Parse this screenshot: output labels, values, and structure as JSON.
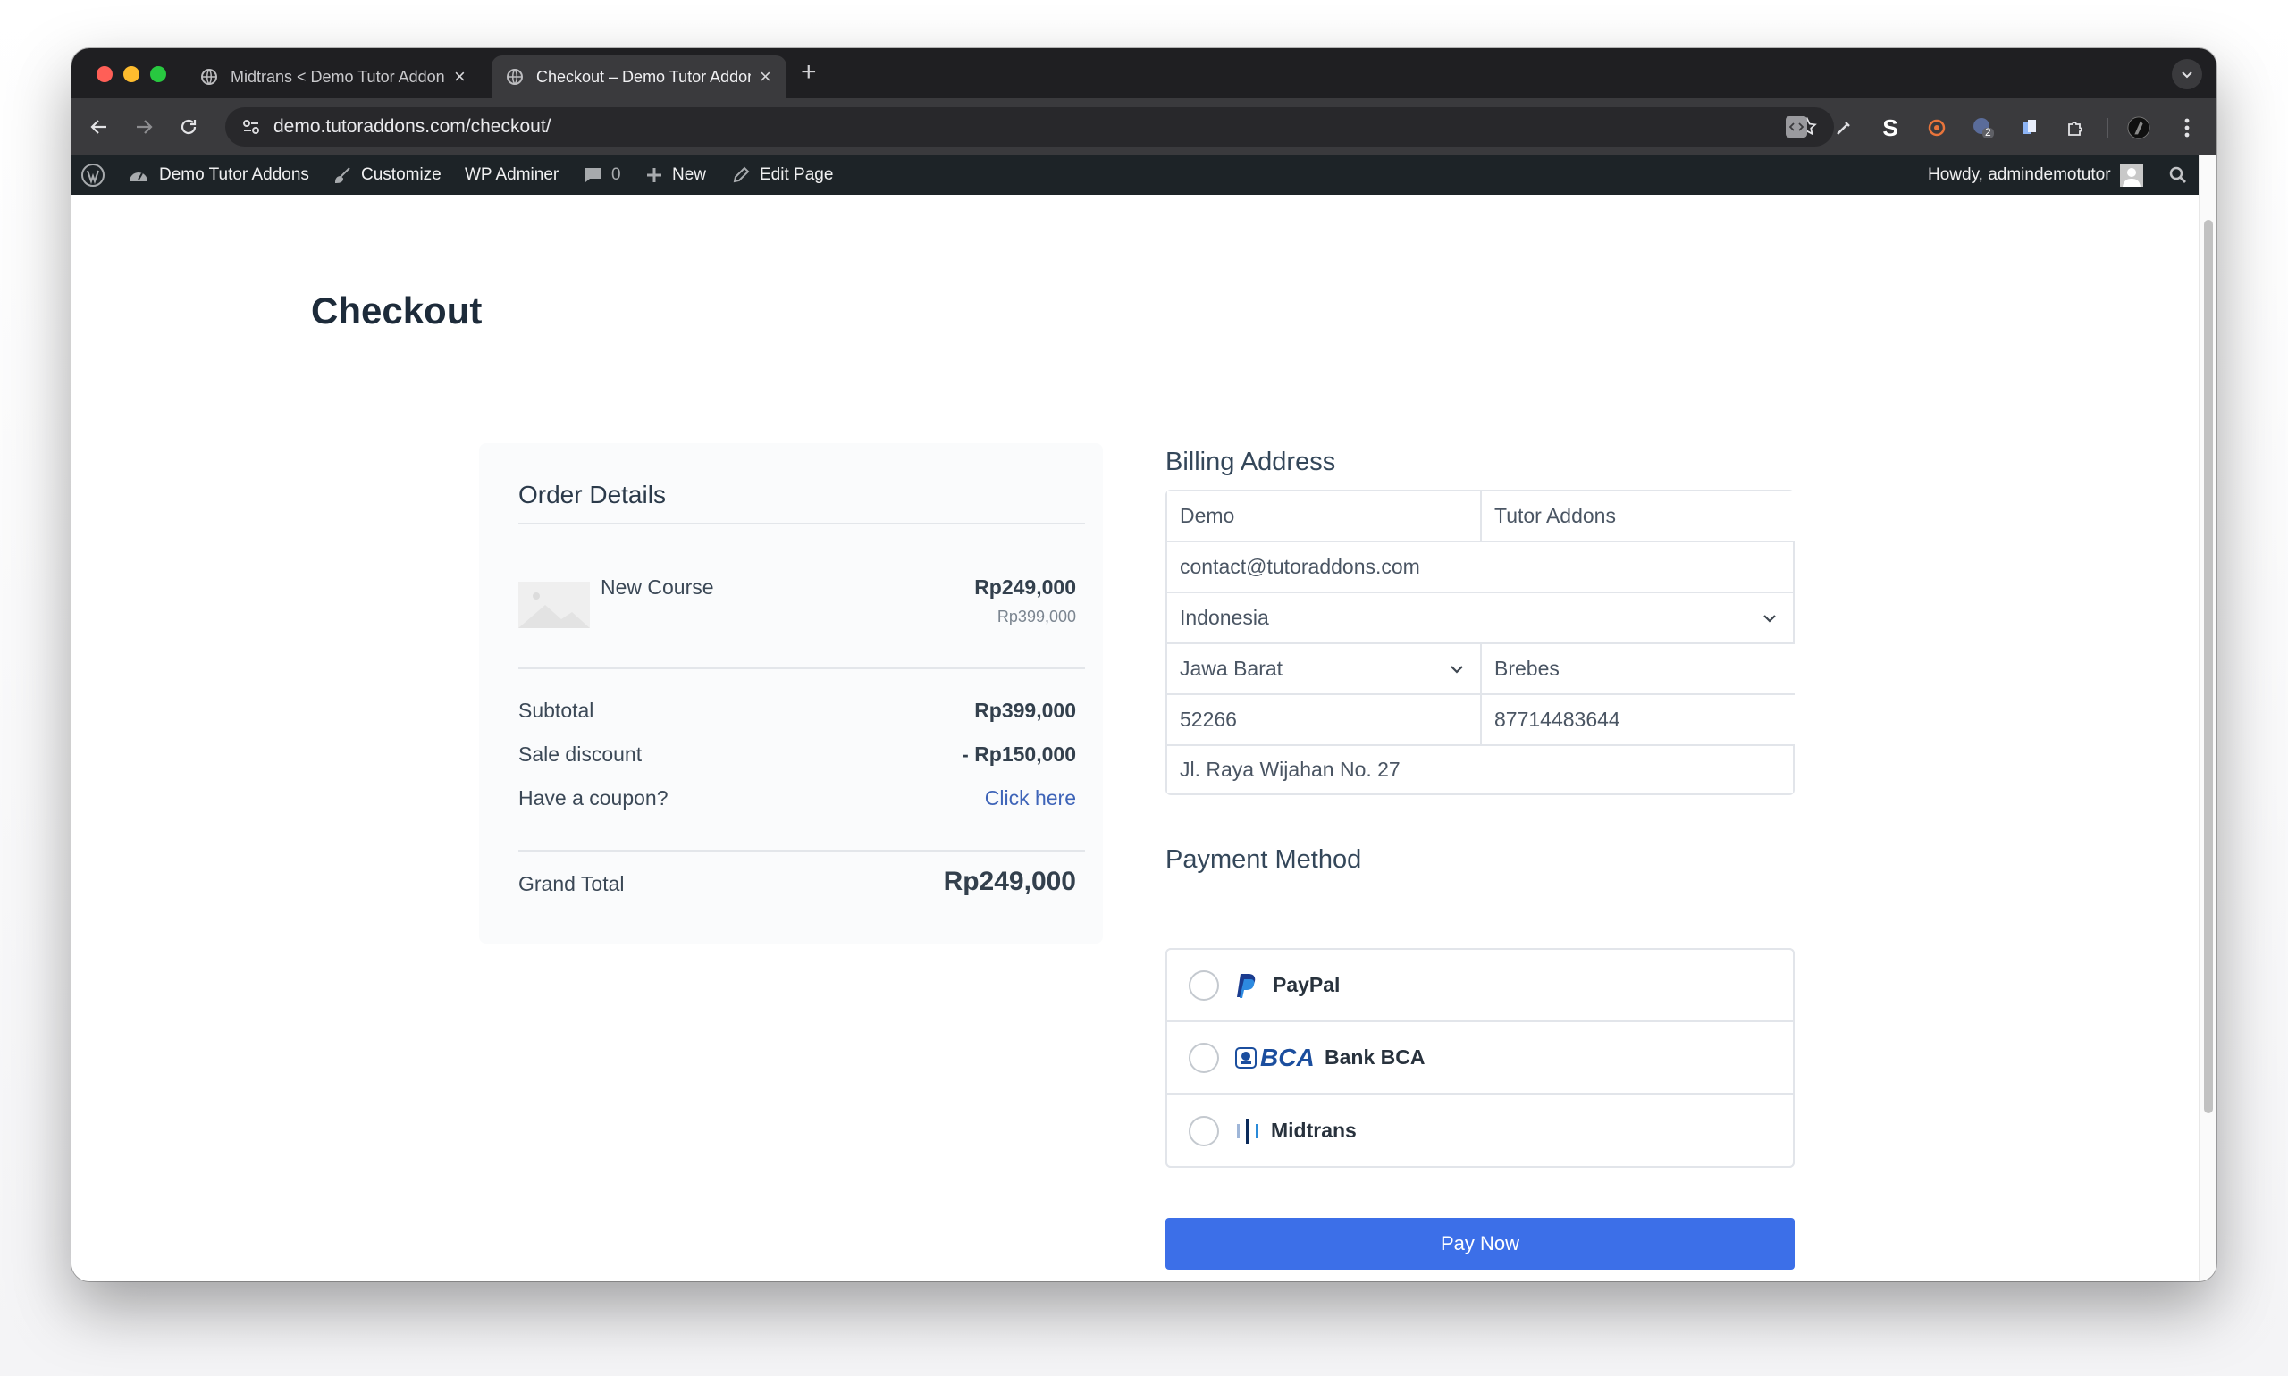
{
  "browser": {
    "tabs": [
      {
        "title": "Midtrans < Demo Tutor Addons",
        "close": "×"
      },
      {
        "title": "Checkout – Demo Tutor Addons",
        "close": "×"
      }
    ],
    "new_tab_label": "+",
    "url": "demo.tutoraddons.com/checkout/",
    "extension_badge": "2"
  },
  "admin_bar": {
    "site_name": "Demo Tutor Addons",
    "customize": "Customize",
    "wp_adminer": "WP Adminer",
    "comments_count": "0",
    "new": "New",
    "edit_page": "Edit Page",
    "howdy": "Howdy, admindemotutor"
  },
  "page": {
    "title": "Checkout"
  },
  "order": {
    "title": "Order Details",
    "item_name": "New Course",
    "item_price": "Rp249,000",
    "item_original_price": "Rp399,000",
    "subtotal_label": "Subtotal",
    "subtotal_value": "Rp399,000",
    "discount_label": "Sale discount",
    "discount_value": "- Rp150,000",
    "coupon_label": "Have a coupon?",
    "coupon_link": "Click here",
    "grand_total_label": "Grand Total",
    "grand_total_value": "Rp249,000"
  },
  "billing": {
    "title": "Billing Address",
    "first_name": "Demo",
    "last_name": "Tutor Addons",
    "email": "contact@tutoraddons.com",
    "country": "Indonesia",
    "state": "Jawa Barat",
    "city": "Brebes",
    "postcode": "52266",
    "phone": "87714483644",
    "address": "Jl. Raya Wijahan No. 27"
  },
  "payment": {
    "title": "Payment Method",
    "methods": [
      {
        "label": "PayPal",
        "icon": "paypal-icon"
      },
      {
        "label": "Bank BCA",
        "icon": "bca-logo",
        "logo_text": "BCA"
      },
      {
        "label": "Midtrans",
        "icon": "midtrans-icon"
      }
    ],
    "pay_button": "Pay Now"
  },
  "colors": {
    "pay_button": "#3c6fe8",
    "admin_bar": "#1d2327",
    "tab_strip": "#1f1f22",
    "link": "#3e64b8"
  }
}
